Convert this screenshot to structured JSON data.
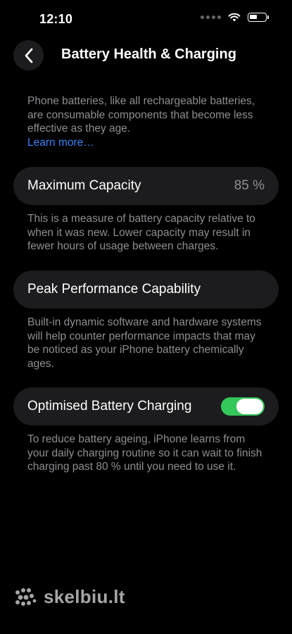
{
  "status_bar": {
    "time": "12:10",
    "icons": [
      "signal-dots-icon",
      "wifi-icon",
      "battery-icon"
    ]
  },
  "nav": {
    "back_icon": "chevron-left-icon",
    "title": "Battery Health & Charging"
  },
  "intro": {
    "text": "Phone batteries, like all rechargeable batteries, are consumable components that become less effective as they age.",
    "link": "Learn more…"
  },
  "sections": {
    "max_capacity": {
      "label": "Maximum Capacity",
      "value": "85 %",
      "footnote": "This is a measure of battery capacity relative to when it was new. Lower capacity may result in fewer hours of usage between charges."
    },
    "peak_performance": {
      "label": "Peak Performance Capability",
      "footnote": "Built-in dynamic software and hardware systems will help counter performance impacts that may be noticed as your iPhone battery chemically ages."
    },
    "optimised_charging": {
      "label": "Optimised Battery Charging",
      "toggle_on": true,
      "footnote": "To reduce battery ageing, iPhone learns from your daily charging routine so it can wait to finish charging past 80 % until you need to use it."
    }
  },
  "colors": {
    "background": "#000000",
    "card": "#1c1c1e",
    "secondary_text": "#8e8e93",
    "link": "#3a82f7",
    "toggle_on": "#34c759"
  },
  "watermark": {
    "text": "skelbiu.lt"
  }
}
